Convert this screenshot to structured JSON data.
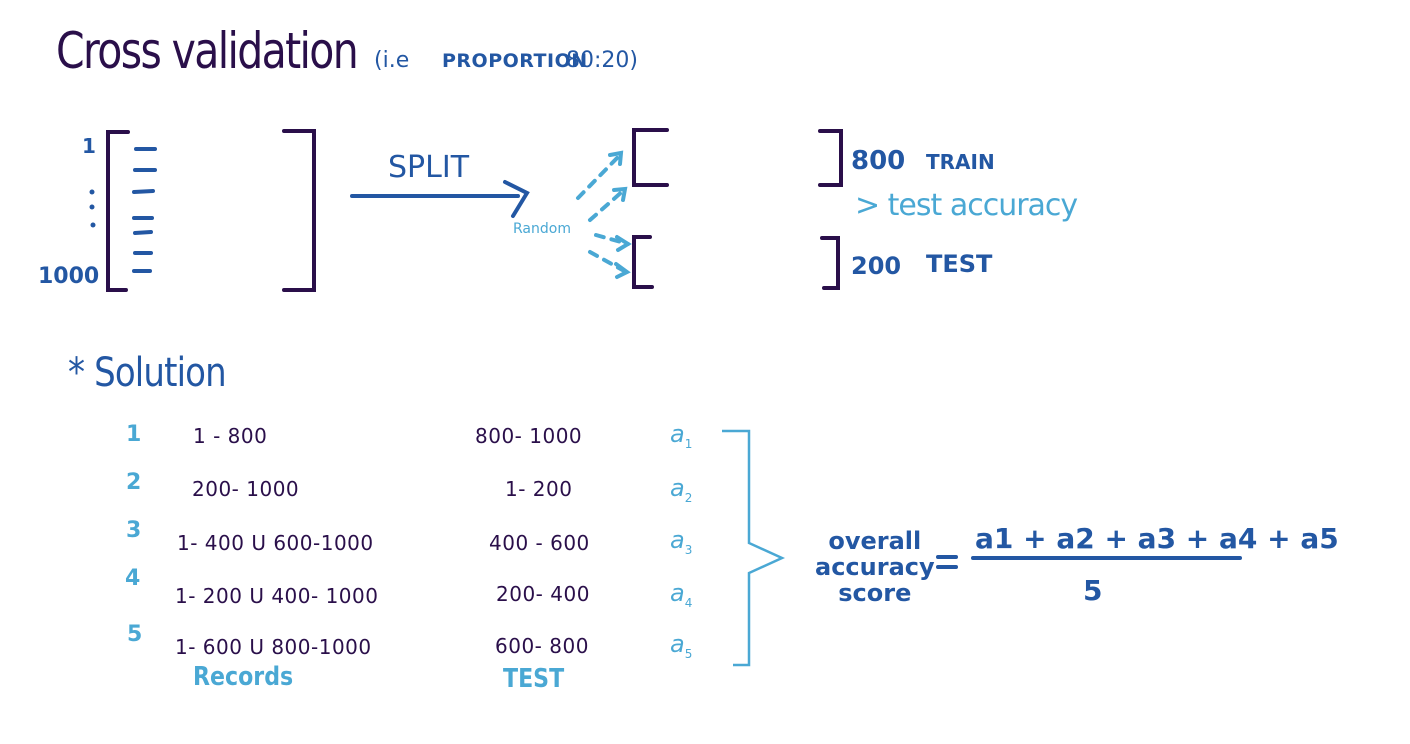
{
  "header": {
    "title": "Cross validation",
    "subtitle_prefix": "(i.e",
    "subtitle_text": "PROPORTION",
    "subtitle_ratio": "80:20)"
  },
  "dataset": {
    "first_index": "1",
    "last_index": "1000"
  },
  "split": {
    "label": "SPLIT",
    "method": "Random",
    "train_count": "800",
    "train_label": "TRAIN",
    "test_count": "200",
    "test_label": "TEST",
    "note": "> test accuracy"
  },
  "solution": {
    "heading": "* Solution",
    "rows": [
      {
        "index": "1",
        "records": "1 - 800",
        "test": "800- 1000",
        "accuracy": "a",
        "sub": "1"
      },
      {
        "index": "2",
        "records": "200- 1000",
        "test": "1- 200",
        "accuracy": "a",
        "sub": "2"
      },
      {
        "index": "3",
        "records": "1- 400  U  600-1000",
        "test": "400 - 600",
        "accuracy": "a",
        "sub": "3"
      },
      {
        "index": "4",
        "records": "1- 200  U  400- 1000",
        "test": "200- 400",
        "accuracy": "a",
        "sub": "4"
      },
      {
        "index": "5",
        "records": "1- 600  U  800-1000",
        "test": "600- 800",
        "accuracy": "a",
        "sub": "5"
      }
    ],
    "records_header": "Records",
    "test_header": "TEST"
  },
  "formula": {
    "label_line1": "overall",
    "label_line2": "accuracy",
    "label_line3": "score",
    "equals": "=",
    "numerator": "a1 + a2 + a3 + a4 + a5",
    "denominator": "5"
  },
  "colors": {
    "dark": "#2a0f4a",
    "mid": "#2357a3",
    "light": "#4aa8d4"
  }
}
